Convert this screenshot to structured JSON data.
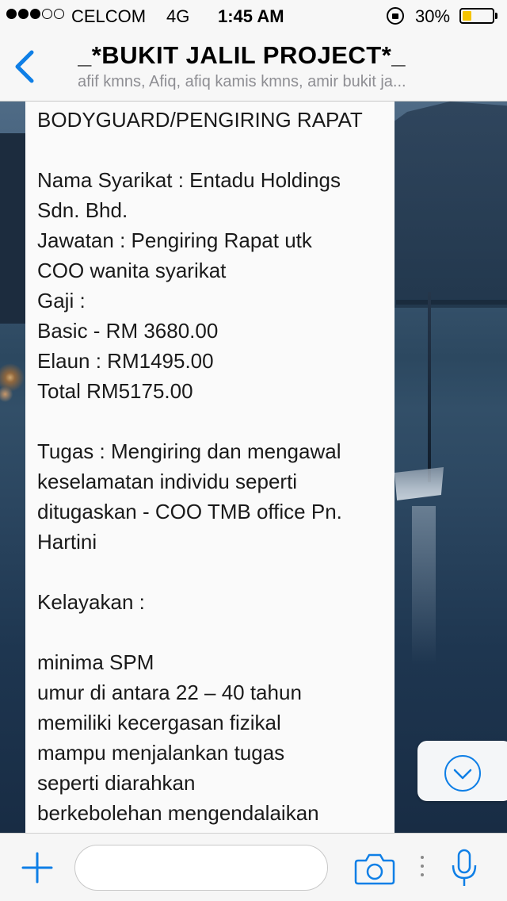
{
  "status_bar": {
    "carrier": "CELCOM",
    "network": "4G",
    "time": "1:45 AM",
    "battery_percent_label": "30%",
    "battery_level": 0.3,
    "signal_filled": 3,
    "signal_total": 5
  },
  "header": {
    "title": "_*BUKIT JALIL PROJECT*_",
    "members": "afif kmns, Afiq, afiq kamis kmns, amir bukit ja..."
  },
  "message": {
    "lines": [
      "BODYGUARD/PENGIRING RAPAT",
      "",
      "Nama Syarikat : Entadu Holdings",
      "Sdn. Bhd.",
      "Jawatan : Pengiring Rapat utk",
      "COO wanita syarikat",
      "Gaji :",
      "Basic - RM 3680.00",
      "Elaun : RM1495.00",
      "Total RM5175.00",
      "",
      "Tugas : Mengiring dan mengawal",
      "keselamatan individu seperti",
      "ditugaskan - COO TMB office Pn.",
      "Hartini",
      "",
      "Kelayakan :",
      "",
      "minima SPM",
      "umur di antara 22 – 40 tahun",
      "memiliki kecergasan fizikal",
      "mampu menjalankan tugas",
      "seperti diarahkan",
      "berkebolehan mengendalaikan"
    ]
  },
  "input": {
    "value": "",
    "placeholder": ""
  },
  "icons": {
    "back": "chevron-left-icon",
    "scroll_down": "chevron-down-circle-icon",
    "plus": "plus-icon",
    "camera": "camera-icon",
    "mic": "microphone-icon"
  },
  "colors": {
    "accent": "#0f7fe6",
    "battery": "#f5c400"
  }
}
